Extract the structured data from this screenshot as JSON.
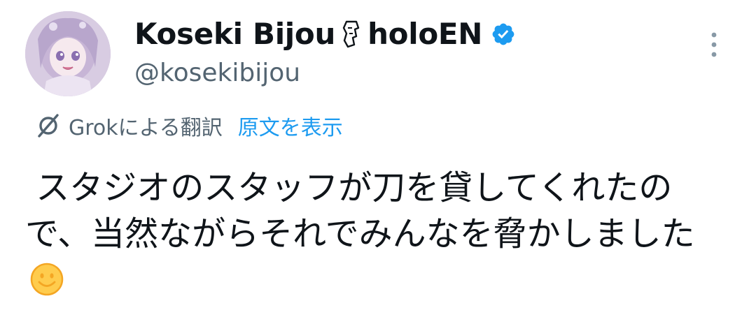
{
  "author": {
    "display_name": "Koseki Bijou",
    "display_name_suffix": "holoEN",
    "name_emoji_icon": "moai-icon",
    "verified_icon": "verified-badge-icon",
    "handle": "@kosekibijou",
    "avatar": "avatar"
  },
  "translation": {
    "translated_by": "Grokによる翻訳",
    "show_original": "原文を表示",
    "icon": "grok-icon"
  },
  "tweet": {
    "text": " スタジオのスタッフが刀を貸してくれたので、当然ながらそれでみんなを脅かしました",
    "trailing_emoji": "smiling-face-icon"
  },
  "menu": {
    "icon": "more-vertical-icon"
  },
  "colors": {
    "primary_text": "#0f1419",
    "secondary_text": "#536471",
    "link": "#1d9bf0",
    "verified": "#1d9bf0"
  }
}
